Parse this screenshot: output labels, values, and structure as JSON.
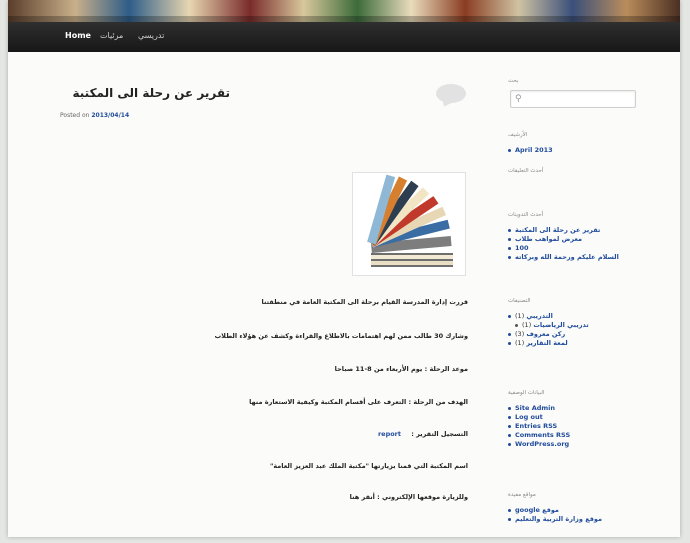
{
  "nav": {
    "items": [
      "Home",
      "مرئيات",
      "تدريسي"
    ]
  },
  "post": {
    "title": "تقرير عن رحلة الى المكتبة",
    "posted_prefix": "Posted on",
    "date": "2013/04/14",
    "paragraphs": [
      "قررت إدارة المدرسة القيام برحلة الى المكتبة العامة في منطقتنا",
      "وشارك 30 طالب ممن لهم اهتمامات بالاطلاع والقراءة وكشف عن هؤلاء الطلاب",
      "موعد الرحلة : يوم الأربعاء من 8-11 صباحا",
      "الهدف من الرحلة : التعرف على أقسام المكتبة وكيفية الاستعارة منها",
      "التسجيل التقرير :",
      "اسم المكتبة التي قمنا بزيارتها \"مكتبة الملك عبد العزيز العامة\"",
      "وللزيارة موقعها الإلكتروني : أنقر هنا"
    ],
    "report_link": "report"
  },
  "sidebar": {
    "search": {
      "title": "بحث",
      "placeholder": ""
    },
    "archives": {
      "title": "الأرشيف",
      "items": [
        "April 2013"
      ]
    },
    "recent_comments": {
      "title": "أحدث التعليقات"
    },
    "recent_posts": {
      "title": "أحدث التدوينات",
      "items": [
        "تقرير عن رحلة الى المكتبة",
        "معرض لمواهب طلاب",
        "100",
        "السلام عليكم ورحمة الله وبركاته"
      ]
    },
    "categories": {
      "title": "التصنيفات",
      "items": [
        {
          "label": "التدريبي",
          "count": "(1)"
        },
        {
          "label": "تدريبي الرياضيات",
          "count": "(1)",
          "sub": true
        },
        {
          "label": "ركن معروف",
          "count": "(3)"
        },
        {
          "label": "لمعة التقارير",
          "count": "(1)"
        }
      ]
    },
    "meta": {
      "title": "البيانات الوصفية",
      "items": [
        "Site Admin",
        "Log out",
        "Entries RSS",
        "Comments RSS",
        "WordPress.org"
      ]
    },
    "links": {
      "title": "مواقع مفيدة",
      "items": [
        "موقع google",
        "موقع وزارة التربية والتعليم"
      ]
    }
  },
  "colors": {
    "link": "#1f4b9c",
    "nav_bg": "#1f1f1f",
    "page_bg": "#fbfbf9"
  },
  "icons": {
    "search": "search-icon",
    "comment": "comment-bubble-icon"
  }
}
